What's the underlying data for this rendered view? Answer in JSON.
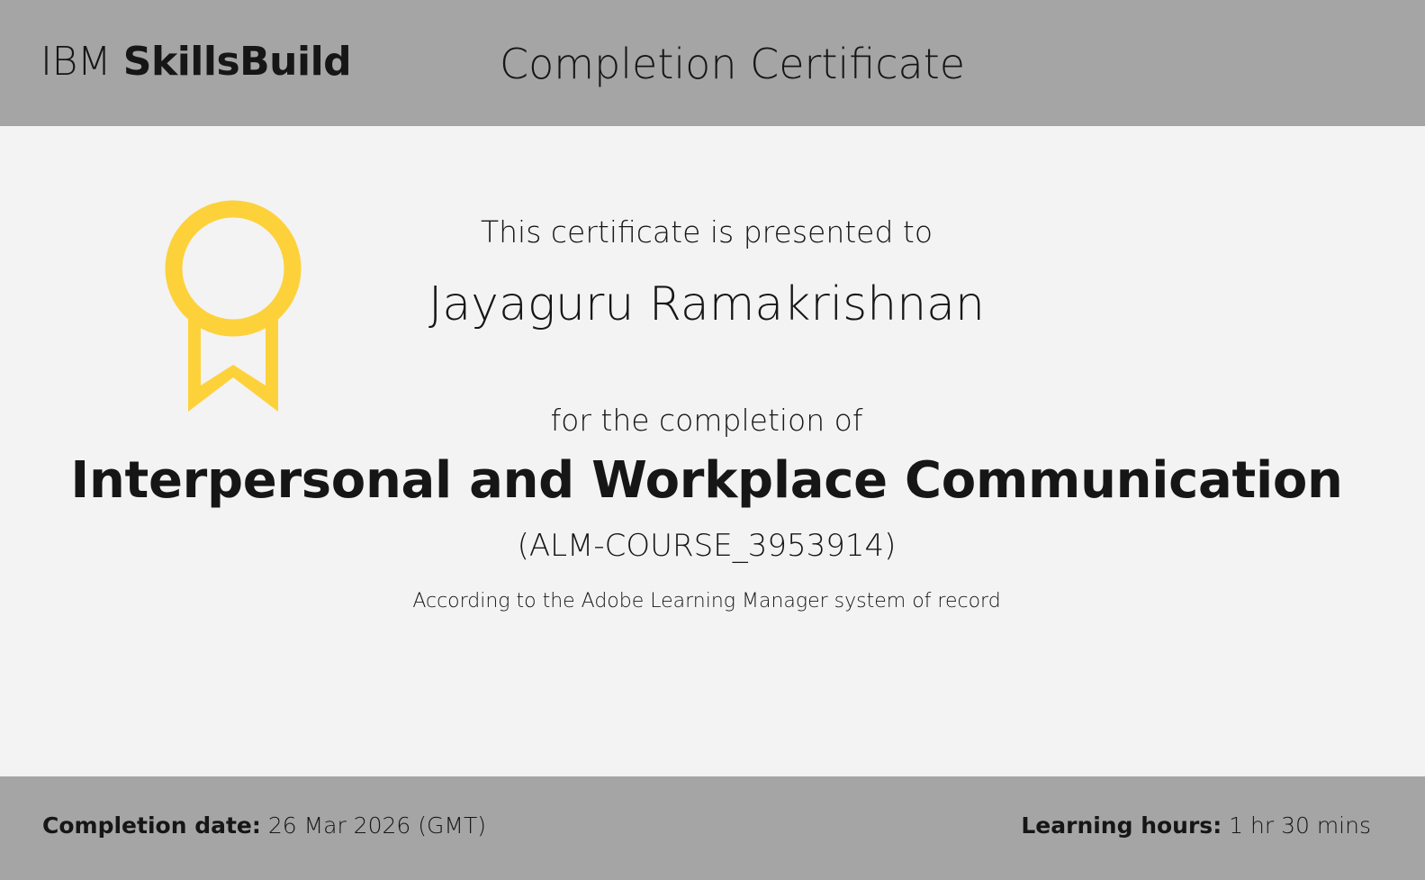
{
  "header": {
    "brand_prefix": "IBM",
    "brand_name": "SkillsBuild",
    "title": "Completion Certificate"
  },
  "certificate": {
    "presented_to_text": "This certificate is presented to",
    "recipient_name": "Jayaguru Ramakrishnan",
    "completion_text": "for the completion of",
    "course_title": "Interpersonal and Workplace Communication",
    "course_code": "(ALM-COURSE_3953914)",
    "record_note": "According to the Adobe Learning Manager system of record",
    "award_icon": "award-ribbon-icon",
    "accent_color": "#fdd13a"
  },
  "footer": {
    "completion_date_label": "Completion date:",
    "completion_date_value": "26 Mar 2026 (GMT)",
    "learning_hours_label": "Learning hours:",
    "learning_hours_value": "1 hr 30 mins"
  },
  "colors": {
    "header_bg": "#a5a5a5",
    "content_bg": "#f3f3f3",
    "text": "#161616"
  }
}
